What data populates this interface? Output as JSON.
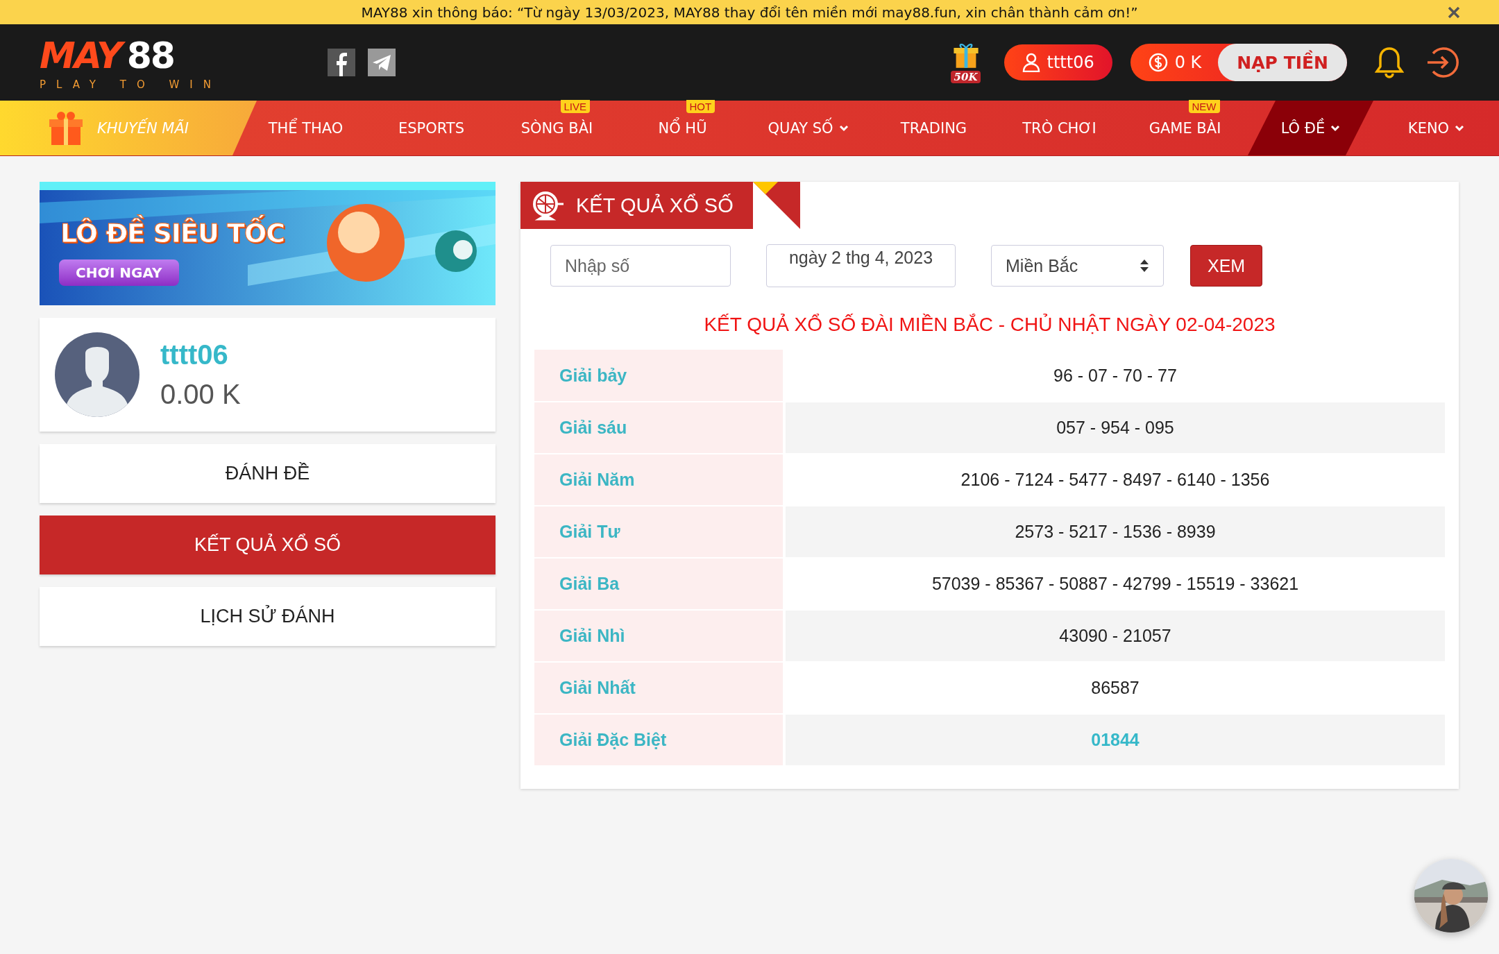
{
  "notice": {
    "text": "MAY88 xin thông báo: “Từ ngày 13/03/2023, MAY88 thay đổi tên miền mới may88.fun, xin chân thành cảm ơn!”"
  },
  "header": {
    "logo_word": "MAY",
    "logo_number": "88",
    "tagline": "PLAY TO WIN",
    "gift_label": "50K",
    "username": "tttt06",
    "balance": "0 K",
    "deposit": "NẠP TIỀN"
  },
  "nav": [
    {
      "kind": "promo",
      "label": "KHUYẾN MÃI",
      "selected": false
    },
    {
      "kind": "link",
      "label": "THỂ THAO",
      "selected": false
    },
    {
      "kind": "link",
      "label": "ESPORTS",
      "selected": false
    },
    {
      "kind": "link",
      "label": "SÒNG BÀI",
      "badge": "LIVE",
      "selected": false
    },
    {
      "kind": "link",
      "label": "NỔ HŨ",
      "badge": "HOT",
      "selected": false
    },
    {
      "kind": "dropdown",
      "label": "QUAY SỐ",
      "selected": false
    },
    {
      "kind": "link",
      "label": "TRADING",
      "selected": false
    },
    {
      "kind": "link",
      "label": "TRÒ CHƠI",
      "selected": false
    },
    {
      "kind": "link",
      "label": "GAME BÀI",
      "badge": "NEW",
      "selected": false
    },
    {
      "kind": "dropdown",
      "label": "LÔ ĐỀ",
      "selected": true
    },
    {
      "kind": "dropdown",
      "label": "KENO",
      "selected": false
    }
  ],
  "banner": {
    "title": "LÔ ĐỀ SIÊU TỐC",
    "button": "CHƠI NGAY"
  },
  "profile": {
    "username": "tttt06",
    "balance": "0.00 K"
  },
  "sidebar": {
    "items": [
      {
        "label": "ĐÁNH ĐỀ",
        "selected": false
      },
      {
        "label": "KẾT QUẢ XỔ SỐ",
        "selected": true
      },
      {
        "label": "LỊCH SỬ ĐÁNH",
        "selected": false
      }
    ]
  },
  "results": {
    "title": "KẾT QUẢ XỔ SỐ",
    "number_field": {
      "placeholder": "Nhập số"
    },
    "date_field": {
      "value": "ngày 2 thg 4, 2023"
    },
    "region_select": {
      "value": "Miền Bắc"
    },
    "view_button": "XEM",
    "heading": "KẾT QUẢ XỔ SỐ ĐÀI MIỀN BẮC - CHỦ NHẬT NGÀY 02-04-2023",
    "rows": [
      {
        "prize": "Giải bảy",
        "numbers": "96 - 07 - 70 - 77",
        "highlight": false
      },
      {
        "prize": "Giải sáu",
        "numbers": "057 - 954 - 095",
        "highlight": false
      },
      {
        "prize": "Giải Năm",
        "numbers": "2106 - 7124 - 5477 - 8497 - 6140 - 1356",
        "highlight": false
      },
      {
        "prize": "Giải Tư",
        "numbers": "2573 - 5217 - 1536 - 8939",
        "highlight": false
      },
      {
        "prize": "Giải Ba",
        "numbers": "57039 - 85367 - 50887 - 42799 - 15519 - 33621",
        "highlight": false
      },
      {
        "prize": "Giải Nhì",
        "numbers": "43090 - 21057",
        "highlight": false
      },
      {
        "prize": "Giải Nhất",
        "numbers": "86587",
        "highlight": false
      },
      {
        "prize": "Giải Đặc Biệt",
        "numbers": "01844",
        "highlight": true
      }
    ]
  }
}
